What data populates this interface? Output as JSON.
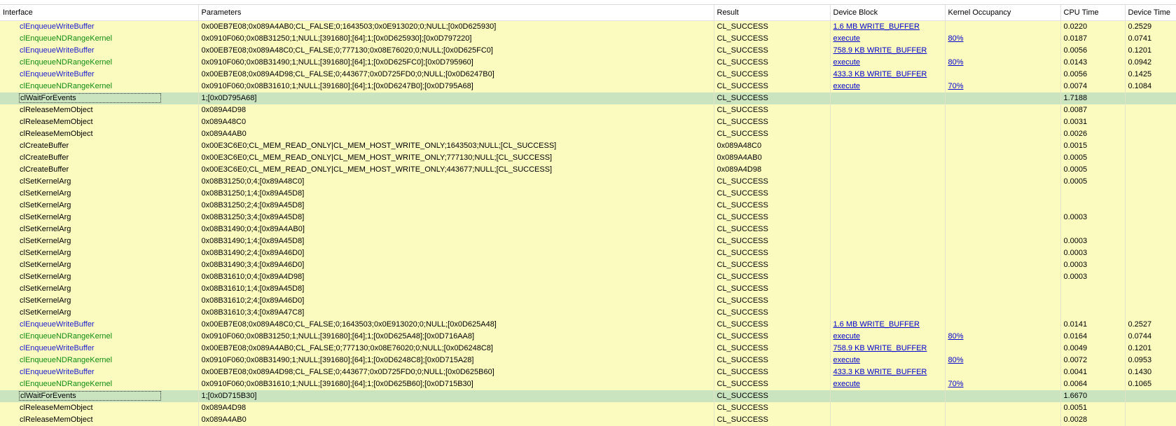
{
  "columns": [
    "Interface",
    "Parameters",
    "Result",
    "Device Block",
    "Kernel Occupancy",
    "CPU Time",
    "Device Time"
  ],
  "colors": {
    "write": "#1c1ccf",
    "kernel": "#118c11",
    "row_bg": "#fbfbbf",
    "selected_bg": "#c9e4bf"
  },
  "rows": [
    {
      "iface": "clEnqueueWriteBuffer",
      "kind": "write",
      "params": "0x00EB7E08;0x089A4AB0;CL_FALSE;0;1643503;0x0E913020;0;NULL;[0x0D625930]",
      "result": "CL_SUCCESS",
      "device_block": "1.6 MB WRITE_BUFFER",
      "occupancy": "",
      "cpu": "0.0220",
      "device": "0.2529"
    },
    {
      "iface": "clEnqueueNDRangeKernel",
      "kind": "kernel",
      "params": "0x0910F060;0x08B31250;1;NULL;[391680];[64];1;[0x0D625930];[0x0D797220]",
      "result": "CL_SUCCESS",
      "device_block": "execute",
      "occupancy": "80%",
      "cpu": "0.0187",
      "device": "0.0741"
    },
    {
      "iface": "clEnqueueWriteBuffer",
      "kind": "write",
      "params": "0x00EB7E08;0x089A48C0;CL_FALSE;0;777130;0x08E76020;0;NULL;[0x0D625FC0]",
      "result": "CL_SUCCESS",
      "device_block": "758.9 KB WRITE_BUFFER",
      "occupancy": "",
      "cpu": "0.0056",
      "device": "0.1201"
    },
    {
      "iface": "clEnqueueNDRangeKernel",
      "kind": "kernel",
      "params": "0x0910F060;0x08B31490;1;NULL;[391680];[64];1;[0x0D625FC0];[0x0D795960]",
      "result": "CL_SUCCESS",
      "device_block": "execute",
      "occupancy": "80%",
      "cpu": "0.0143",
      "device": "0.0942"
    },
    {
      "iface": "clEnqueueWriteBuffer",
      "kind": "write",
      "params": "0x00EB7E08;0x089A4D98;CL_FALSE;0;443677;0x0D725FD0;0;NULL;[0x0D6247B0]",
      "result": "CL_SUCCESS",
      "device_block": "433.3 KB WRITE_BUFFER",
      "occupancy": "",
      "cpu": "0.0056",
      "device": "0.1425"
    },
    {
      "iface": "clEnqueueNDRangeKernel",
      "kind": "kernel",
      "params": "0x0910F060;0x08B31610;1;NULL;[391680];[64];1;[0x0D6247B0];[0x0D795A68]",
      "result": "CL_SUCCESS",
      "device_block": "execute",
      "occupancy": "70%",
      "cpu": "0.0074",
      "device": "0.1084"
    },
    {
      "iface": "clWaitForEvents",
      "kind": "plain",
      "selected": true,
      "params": "1;[0x0D795A68]",
      "result": "CL_SUCCESS",
      "device_block": "",
      "occupancy": "",
      "cpu": "1.7188",
      "device": ""
    },
    {
      "iface": "clReleaseMemObject",
      "kind": "plain",
      "params": "0x089A4D98",
      "result": "CL_SUCCESS",
      "device_block": "",
      "occupancy": "",
      "cpu": "0.0087",
      "device": ""
    },
    {
      "iface": "clReleaseMemObject",
      "kind": "plain",
      "params": "0x089A48C0",
      "result": "CL_SUCCESS",
      "device_block": "",
      "occupancy": "",
      "cpu": "0.0031",
      "device": ""
    },
    {
      "iface": "clReleaseMemObject",
      "kind": "plain",
      "params": "0x089A4AB0",
      "result": "CL_SUCCESS",
      "device_block": "",
      "occupancy": "",
      "cpu": "0.0026",
      "device": ""
    },
    {
      "iface": "clCreateBuffer",
      "kind": "plain",
      "params": "0x00E3C6E0;CL_MEM_READ_ONLY|CL_MEM_HOST_WRITE_ONLY;1643503;NULL;[CL_SUCCESS]",
      "result": "0x089A48C0",
      "device_block": "",
      "occupancy": "",
      "cpu": "0.0015",
      "device": ""
    },
    {
      "iface": "clCreateBuffer",
      "kind": "plain",
      "params": "0x00E3C6E0;CL_MEM_READ_ONLY|CL_MEM_HOST_WRITE_ONLY;777130;NULL;[CL_SUCCESS]",
      "result": "0x089A4AB0",
      "device_block": "",
      "occupancy": "",
      "cpu": "0.0005",
      "device": ""
    },
    {
      "iface": "clCreateBuffer",
      "kind": "plain",
      "params": "0x00E3C6E0;CL_MEM_READ_ONLY|CL_MEM_HOST_WRITE_ONLY;443677;NULL;[CL_SUCCESS]",
      "result": "0x089A4D98",
      "device_block": "",
      "occupancy": "",
      "cpu": "0.0005",
      "device": ""
    },
    {
      "iface": "clSetKernelArg",
      "kind": "plain",
      "params": "0x08B31250;0;4;[0x89A48C0]",
      "result": "CL_SUCCESS",
      "device_block": "",
      "occupancy": "",
      "cpu": "0.0005",
      "device": ""
    },
    {
      "iface": "clSetKernelArg",
      "kind": "plain",
      "params": "0x08B31250;1;4;[0x89A45D8]",
      "result": "CL_SUCCESS",
      "device_block": "",
      "occupancy": "",
      "cpu": "",
      "device": ""
    },
    {
      "iface": "clSetKernelArg",
      "kind": "plain",
      "params": "0x08B31250;2;4;[0x89A45D8]",
      "result": "CL_SUCCESS",
      "device_block": "",
      "occupancy": "",
      "cpu": "",
      "device": ""
    },
    {
      "iface": "clSetKernelArg",
      "kind": "plain",
      "params": "0x08B31250;3;4;[0x89A45D8]",
      "result": "CL_SUCCESS",
      "device_block": "",
      "occupancy": "",
      "cpu": "0.0003",
      "device": ""
    },
    {
      "iface": "clSetKernelArg",
      "kind": "plain",
      "params": "0x08B31490;0;4;[0x89A4AB0]",
      "result": "CL_SUCCESS",
      "device_block": "",
      "occupancy": "",
      "cpu": "",
      "device": ""
    },
    {
      "iface": "clSetKernelArg",
      "kind": "plain",
      "params": "0x08B31490;1;4;[0x89A45D8]",
      "result": "CL_SUCCESS",
      "device_block": "",
      "occupancy": "",
      "cpu": "0.0003",
      "device": ""
    },
    {
      "iface": "clSetKernelArg",
      "kind": "plain",
      "params": "0x08B31490;2;4;[0x89A46D0]",
      "result": "CL_SUCCESS",
      "device_block": "",
      "occupancy": "",
      "cpu": "0.0003",
      "device": ""
    },
    {
      "iface": "clSetKernelArg",
      "kind": "plain",
      "params": "0x08B31490;3;4;[0x89A46D0]",
      "result": "CL_SUCCESS",
      "device_block": "",
      "occupancy": "",
      "cpu": "0.0003",
      "device": ""
    },
    {
      "iface": "clSetKernelArg",
      "kind": "plain",
      "params": "0x08B31610;0;4;[0x89A4D98]",
      "result": "CL_SUCCESS",
      "device_block": "",
      "occupancy": "",
      "cpu": "0.0003",
      "device": ""
    },
    {
      "iface": "clSetKernelArg",
      "kind": "plain",
      "params": "0x08B31610;1;4;[0x89A45D8]",
      "result": "CL_SUCCESS",
      "device_block": "",
      "occupancy": "",
      "cpu": "",
      "device": ""
    },
    {
      "iface": "clSetKernelArg",
      "kind": "plain",
      "params": "0x08B31610;2;4;[0x89A46D0]",
      "result": "CL_SUCCESS",
      "device_block": "",
      "occupancy": "",
      "cpu": "",
      "device": ""
    },
    {
      "iface": "clSetKernelArg",
      "kind": "plain",
      "params": "0x08B31610;3;4;[0x89A47C8]",
      "result": "CL_SUCCESS",
      "device_block": "",
      "occupancy": "",
      "cpu": "",
      "device": ""
    },
    {
      "iface": "clEnqueueWriteBuffer",
      "kind": "write",
      "params": "0x00EB7E08;0x089A48C0;CL_FALSE;0;1643503;0x0E913020;0;NULL;[0x0D625A48]",
      "result": "CL_SUCCESS",
      "device_block": "1.6 MB WRITE_BUFFER",
      "occupancy": "",
      "cpu": "0.0141",
      "device": "0.2527"
    },
    {
      "iface": "clEnqueueNDRangeKernel",
      "kind": "kernel",
      "params": "0x0910F060;0x08B31250;1;NULL;[391680];[64];1;[0x0D625A48];[0x0D716AA8]",
      "result": "CL_SUCCESS",
      "device_block": "execute",
      "occupancy": "80%",
      "cpu": "0.0164",
      "device": "0.0744"
    },
    {
      "iface": "clEnqueueWriteBuffer",
      "kind": "write",
      "params": "0x00EB7E08;0x089A4AB0;CL_FALSE;0;777130;0x08E76020;0;NULL;[0x0D6248C8]",
      "result": "CL_SUCCESS",
      "device_block": "758.9 KB WRITE_BUFFER",
      "occupancy": "",
      "cpu": "0.0049",
      "device": "0.1201"
    },
    {
      "iface": "clEnqueueNDRangeKernel",
      "kind": "kernel",
      "params": "0x0910F060;0x08B31490;1;NULL;[391680];[64];1;[0x0D6248C8];[0x0D715A28]",
      "result": "CL_SUCCESS",
      "device_block": "execute",
      "occupancy": "80%",
      "cpu": "0.0072",
      "device": "0.0953"
    },
    {
      "iface": "clEnqueueWriteBuffer",
      "kind": "write",
      "params": "0x00EB7E08;0x089A4D98;CL_FALSE;0;443677;0x0D725FD0;0;NULL;[0x0D625B60]",
      "result": "CL_SUCCESS",
      "device_block": "433.3 KB WRITE_BUFFER",
      "occupancy": "",
      "cpu": "0.0041",
      "device": "0.1430"
    },
    {
      "iface": "clEnqueueNDRangeKernel",
      "kind": "kernel",
      "params": "0x0910F060;0x08B31610;1;NULL;[391680];[64];1;[0x0D625B60];[0x0D715B30]",
      "result": "CL_SUCCESS",
      "device_block": "execute",
      "occupancy": "70%",
      "cpu": "0.0064",
      "device": "0.1065"
    },
    {
      "iface": "clWaitForEvents",
      "kind": "plain",
      "selected": true,
      "params": "1;[0x0D715B30]",
      "result": "CL_SUCCESS",
      "device_block": "",
      "occupancy": "",
      "cpu": "1.6670",
      "device": ""
    },
    {
      "iface": "clReleaseMemObject",
      "kind": "plain",
      "params": "0x089A4D98",
      "result": "CL_SUCCESS",
      "device_block": "",
      "occupancy": "",
      "cpu": "0.0051",
      "device": ""
    },
    {
      "iface": "clReleaseMemObject",
      "kind": "plain",
      "params": "0x089A4AB0",
      "result": "CL_SUCCESS",
      "device_block": "",
      "occupancy": "",
      "cpu": "0.0028",
      "device": ""
    }
  ]
}
